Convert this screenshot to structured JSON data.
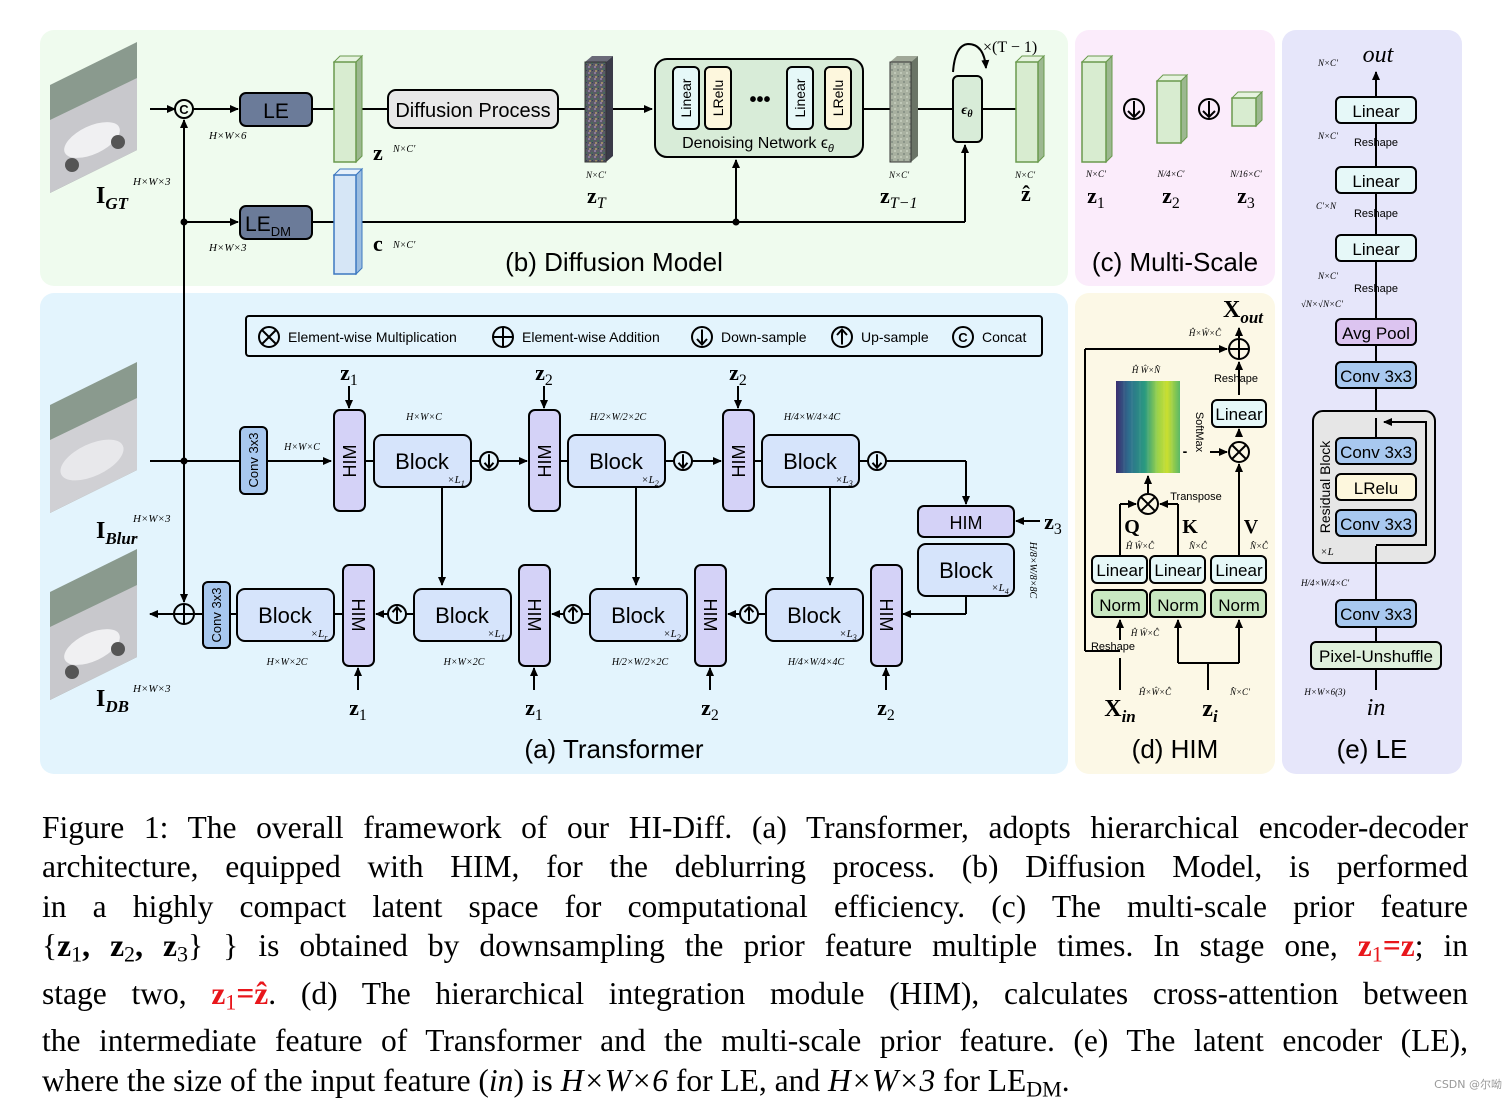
{
  "panels": {
    "diffusion": {
      "label": "(b) Diffusion Model",
      "bg": "#effbee"
    },
    "multiscale": {
      "label": "(c) Multi-Scale",
      "bg": "#fbecfb"
    },
    "le": {
      "label": "(e) LE",
      "bg": "#e6e6fa"
    },
    "transformer": {
      "label": "(a) Transformer",
      "bg": "#e3f4fd"
    },
    "him": {
      "label": "(d) HIM",
      "bg": "#fcf8e6"
    }
  },
  "colors": {
    "le_box": "#6b7b99",
    "latent_green": "#d8ecd0",
    "latent_green_edge": "#6a9a4e",
    "cond_blue": "#d6e6f6",
    "cond_blue_edge": "#3d78c0",
    "block": "#d6e4fb",
    "him": "#d4d2f7",
    "linear": "#e6f8f8",
    "lrelu": "#fdf7dd",
    "avgpool": "#dcc4f0",
    "conv": "#a8c8ef",
    "norm": "#c9e8c2",
    "pixel_unshuffle": "#dff0dc",
    "residual_bg": "#e6e6e6",
    "denoise_bg": "#d8ecd8",
    "caption_red": "#e8161b"
  },
  "diffusion": {
    "inputs": {
      "gt_label": "I",
      "gt_sub": "GT",
      "gt_dim": "H×W×3"
    },
    "le_label": "LE",
    "le_dim": "H×W×6",
    "ledm_label": "LE",
    "ledm_sub": "DM",
    "ledm_dim": "H×W×3",
    "z_label": "z",
    "z_dim": "N×C′",
    "c_label": "c",
    "c_dim": "N×C′",
    "diffusion_process": "Diffusion Process",
    "zT_label": "z",
    "zT_sub": "T",
    "zT_dim": "N×C′",
    "denoise_layers": [
      "Linear",
      "LRelu",
      "•••",
      "Linear",
      "LRelu"
    ],
    "denoise_label": "Denoising Network ϵ",
    "denoise_sub": "θ",
    "zT1_label": "z",
    "zT1_sub": "T−1",
    "zT1_dim": "N×C′",
    "eps_label": "ϵ",
    "eps_sub": "θ",
    "loop_label": "×(T − 1)",
    "zhat_label": "ẑ",
    "zhat_dim": "N×C′"
  },
  "multiscale": {
    "items": [
      {
        "label": "z",
        "sub": "1",
        "dim": "N×C′"
      },
      {
        "label": "z",
        "sub": "2",
        "dim": "N/4×C′"
      },
      {
        "label": "z",
        "sub": "3",
        "dim": "N/16×C′"
      }
    ]
  },
  "legend": {
    "items": [
      {
        "icon": "multiply-circle-icon",
        "label": "Element-wise  Multiplication"
      },
      {
        "icon": "add-circle-icon",
        "label": "Element-wise Addition"
      },
      {
        "icon": "down-sample-icon",
        "label": "Down-sample"
      },
      {
        "icon": "up-sample-icon",
        "label": "Up-sample"
      },
      {
        "icon": "concat-icon",
        "label": "Concat"
      }
    ]
  },
  "transformer": {
    "blur_label": "I",
    "blur_sub": "Blur",
    "blur_dim": "H×W×3",
    "db_label": "I",
    "db_sub": "DB",
    "db_dim": "H×W×3",
    "conv_label": "Conv 3x3",
    "conv_dim": "H×W×C",
    "him_label": "HIM",
    "block_label": "Block",
    "encoder": [
      {
        "z": "1",
        "dim": "H×W×C",
        "rep": "L",
        "rep_sub": "1"
      },
      {
        "z": "2",
        "dim": "H/2×W/2×2C",
        "rep": "L",
        "rep_sub": "2"
      },
      {
        "z": "2",
        "dim": "H/4×W/4×4C",
        "rep": "L",
        "rep_sub": "3"
      }
    ],
    "bottleneck": {
      "z": "3",
      "dim": "H/8×W/8×8C",
      "rep": "L",
      "rep_sub": "4"
    },
    "decoder": [
      {
        "z": "1",
        "dim": "H×W×2C",
        "rep": "L",
        "rep_sub": "r"
      },
      {
        "z": "1",
        "dim": "H×W×2C",
        "rep": "L",
        "rep_sub": "1"
      },
      {
        "z": "2",
        "dim": "H/2×W/2×2C",
        "rep": "L",
        "rep_sub": "2"
      },
      {
        "z": "2",
        "dim": "H/4×W/4×4C",
        "rep": "L",
        "rep_sub": "3"
      }
    ]
  },
  "him": {
    "out_label": "X",
    "out_sub": "out",
    "out_dim": "Ĥ×Ŵ×Ĉ",
    "attn_dim": "Ĥ Ŵ×N̂",
    "reshape": "Reshape",
    "softmax": "SoftMax",
    "transpose": "Transpose",
    "linear": "Linear",
    "norm": "Norm",
    "q": "Q",
    "q_dim": "Ĥ Ŵ×Ĉ",
    "k": "K",
    "k_dim": "N̂×Ĉ",
    "v": "V",
    "v_dim": "N̂×Ĉ",
    "norm_dim": "Ĥ Ŵ×Ĉ",
    "in_label": "X",
    "in_sub": "in",
    "in_dim": "Ĥ×Ŵ×Ĉ",
    "zi_label": "z",
    "zi_sub": "i",
    "zi_dim": "N̂×C′"
  },
  "le": {
    "out_label": "out",
    "out_dim": "N×C′",
    "layers": [
      {
        "label": "Linear",
        "kind": "linear"
      },
      {
        "label": "Linear",
        "kind": "linear"
      },
      {
        "label": "Linear",
        "kind": "linear"
      },
      {
        "label": "Avg Pool",
        "kind": "avgpool"
      },
      {
        "label": "Conv 3x3",
        "kind": "conv"
      }
    ],
    "dims": [
      "N×C′",
      "C′×N",
      "N×C′",
      "√N×√N×C′"
    ],
    "reshape": "Reshape",
    "residual_label": "Residual Block",
    "residual_rep": "×L",
    "residual_layers": [
      "Conv 3x3",
      "LRelu",
      "Conv 3x3"
    ],
    "mid_dim": "H/4×W/4×C′",
    "conv_label": "Conv 3x3",
    "unshuffle_label": "Pixel-Unshuffle",
    "in_dim": "H×W×6(3)",
    "in_label": "in"
  },
  "caption": {
    "l1": "Figure 1: The overall framework of our HI-Diff. (a) Transformer, adopts hierarchical encoder-decoder",
    "l2": "architecture, equipped with HIM, for the deblurring process.  (b) Diffusion Model, is performed",
    "l3": "in a highly compact latent space for computational efficiency.  (c) The multi-scale prior feature",
    "l4a": "{",
    "l4b": "} is obtained by downsampling the prior feature multiple times. In stage one,",
    "l4c": "; in",
    "l5a": "stage two,",
    "l5b": ". (d) The hierarchical integration module (HIM), calculates cross-attention between",
    "l6": "the intermediate feature of Transformer and the multi-scale prior feature. (e) The latent encoder (LE),",
    "l7a": "where the size of the input feature (",
    "l7b": "in",
    "l7c": ") is ",
    "l7d": "H×W×6",
    "l7e": " for LE, and ",
    "l7f": "H×W×3",
    "l7g": " for LE",
    "l7h": "DM",
    "l7i": ".",
    "z_set": "z1, z2, z3",
    "stage_one": "z1=z",
    "stage_two": "z1=ẑ"
  },
  "watermark": "CSDN @尔呦"
}
